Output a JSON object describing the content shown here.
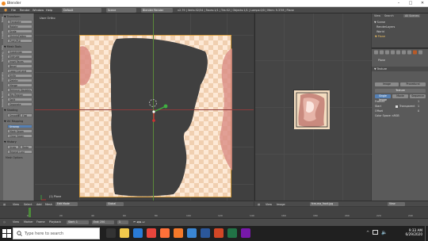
{
  "window": {
    "title": "Blender",
    "min": "–",
    "max": "□",
    "close": "✕"
  },
  "menubar": {
    "items": [
      "File",
      "Render",
      "Window",
      "Help"
    ],
    "layout": "Default",
    "scene": "Scene",
    "engine": "Blender Render",
    "stats": "v2.79 | Verts:32/54 | Faces:1/1 | Tris:52 | Objects:1/1 | Lamps:0/0 | Mem: 9.37M | Plane"
  },
  "toolshelf": {
    "tabs": [
      "Tools",
      "Create",
      "Shading / UVs",
      "Options",
      "Grease Pencil"
    ],
    "sections": [
      {
        "header": "▼ Transform",
        "buttons": [
          "Translate",
          "Rotate",
          "Scale",
          "Shrink/Fatten",
          "Push/Pull"
        ]
      },
      {
        "header": "▼ Mesh Tools",
        "buttons": [
          "Subdivide",
          "Extrude",
          "Inset Faces",
          "Bevel",
          "Loop Cut and Slide",
          "Knife",
          "Delete",
          "Merge",
          "Remove Doubles",
          "Rip Region",
          "Split",
          "Separate"
        ]
      },
      {
        "header": "▼ Shading",
        "buttons": [
          "Smooth",
          "Flat"
        ]
      },
      {
        "header": "▼ UV Mapping",
        "buttons": [
          "Unwrap",
          "Mark Seam",
          "Clear Seam"
        ]
      }
    ],
    "history_header": "▼ History",
    "history_buttons": [
      "Undo",
      "Redo",
      "Repeat Last"
    ],
    "check_label": "Mesh Options"
  },
  "viewport": {
    "label": "User Ortho",
    "object_label": "(1) Plane",
    "header": [
      "View",
      "Select",
      "Add",
      "Mesh"
    ],
    "mode": "Edit Mode",
    "pivot": "Global"
  },
  "imgeditor": {
    "header": [
      "View",
      "Image"
    ],
    "image_name": "fcm-ma_front.jpg",
    "mode": "View"
  },
  "outliner": {
    "header": [
      "View",
      "Search",
      "All Scenes"
    ],
    "rows": [
      "▼ Scene",
      "  RenderLayers",
      "  World",
      "▼ Plane"
    ]
  },
  "props": {
    "object": "Plane",
    "header": "▼ Texture",
    "tabs": [
      "Image",
      "Procedural"
    ],
    "texture_name": "Texture",
    "source_buttons": [
      "Single Image",
      "Movie",
      "Sequence"
    ],
    "fields": [
      {
        "label": "Frames",
        "value": "1"
      },
      {
        "label": "Start",
        "value": "1"
      },
      {
        "label": "Offset",
        "value": "0"
      }
    ],
    "checkbox": "Transparent",
    "color_label": "Color Space: sRGB"
  },
  "timeline": {
    "header": [
      "View",
      "Marker",
      "Frame",
      "Playback"
    ],
    "start": "Start: 1",
    "end": "End: 250",
    "current": "1",
    "ticks": [
      "0",
      "20",
      "40",
      "60",
      "80",
      "100",
      "120",
      "140",
      "160",
      "180",
      "200",
      "220",
      "240"
    ]
  },
  "taskbar": {
    "search_placeholder": "Type here to search",
    "time": "9:33 AM",
    "date": "6/29/2020",
    "apps": [
      {
        "name": "task-view-icon",
        "color": "#333333"
      },
      {
        "name": "file-explorer-icon",
        "color": "#f2c94c"
      },
      {
        "name": "edge-icon",
        "color": "#2a7bd6"
      },
      {
        "name": "chrome-icon",
        "color": "#e8453c"
      },
      {
        "name": "firefox-icon",
        "color": "#ff7139"
      },
      {
        "name": "blender-icon",
        "color": "#f5792a"
      },
      {
        "name": "mail-icon",
        "color": "#3a86d4"
      },
      {
        "name": "word-icon",
        "color": "#2b579a"
      },
      {
        "name": "powerpoint-icon",
        "color": "#d24726"
      },
      {
        "name": "excel-icon",
        "color": "#217346"
      },
      {
        "name": "onenote-icon",
        "color": "#7719aa"
      }
    ]
  }
}
